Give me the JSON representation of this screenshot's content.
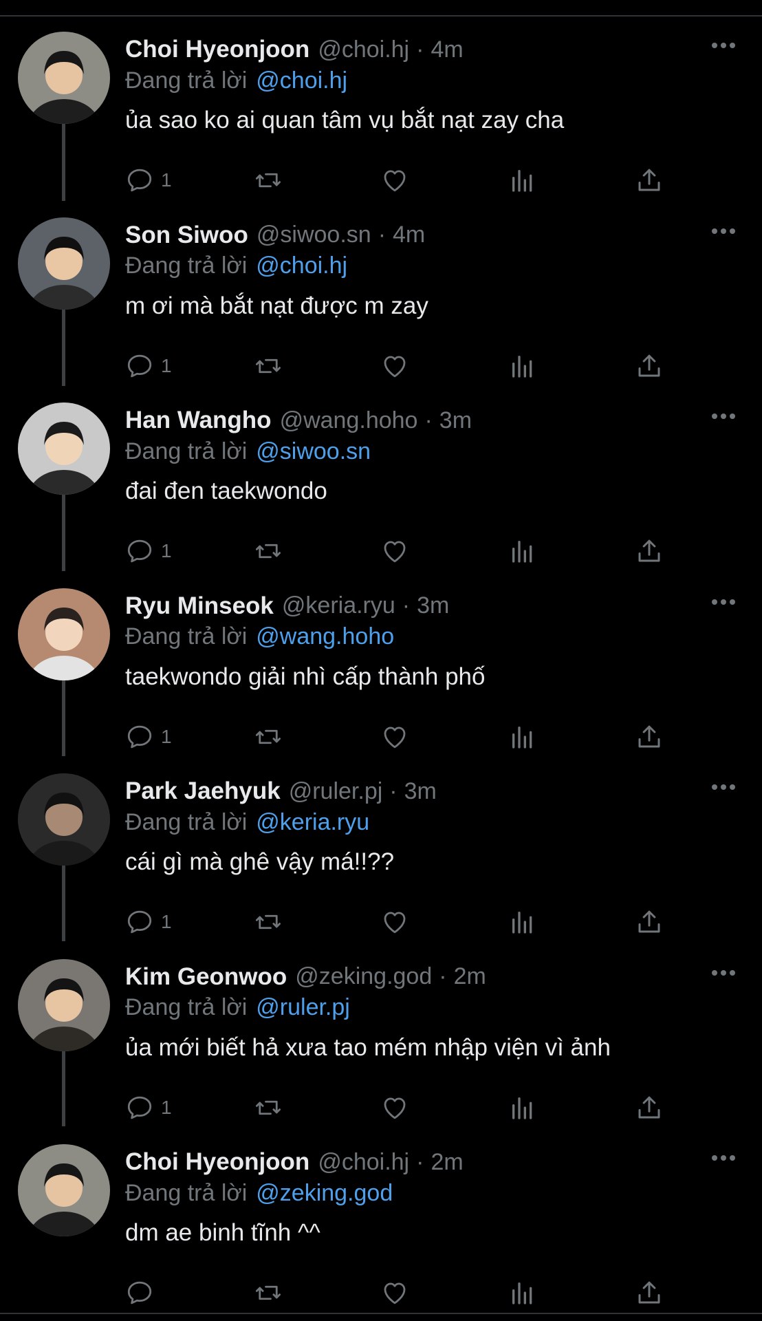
{
  "thread": {
    "reply_prefix": "Đang trả lời",
    "more_icon": "more-horizontal-icon",
    "tweets": [
      {
        "name": "Choi Hyeonjoon",
        "handle": "@choi.hj",
        "separator": "·",
        "time": "4m",
        "reply_to": "@choi.hj",
        "text": "ủa sao ko ai quan tâm vụ bắt nạt zay cha",
        "reply_count": "1"
      },
      {
        "name": "Son Siwoo",
        "handle": "@siwoo.sn",
        "separator": "·",
        "time": "4m",
        "reply_to": "@choi.hj",
        "text": "m ơi mà bắt nạt được m zay",
        "reply_count": "1"
      },
      {
        "name": "Han Wangho",
        "handle": "@wang.hoho",
        "separator": "·",
        "time": "3m",
        "reply_to": "@siwoo.sn",
        "text": "đai đen taekwondo",
        "reply_count": "1"
      },
      {
        "name": "Ryu Minseok",
        "handle": "@keria.ryu",
        "separator": "·",
        "time": "3m",
        "reply_to": "@wang.hoho",
        "text": "taekwondo giải nhì cấp thành phố",
        "reply_count": "1"
      },
      {
        "name": "Park Jaehyuk",
        "handle": "@ruler.pj",
        "separator": "·",
        "time": "3m",
        "reply_to": "@keria.ryu",
        "text": "cái gì mà ghê vậy má!!??",
        "reply_count": "1"
      },
      {
        "name": "Kim Geonwoo",
        "handle": "@zeking.god",
        "separator": "·",
        "time": "2m",
        "reply_to": "@ruler.pj",
        "text": "ủa mới biết hả xưa tao mém nhập viện vì ảnh",
        "reply_count": "1"
      },
      {
        "name": "Choi Hyeonjoon",
        "handle": "@choi.hj",
        "separator": "·",
        "time": "2m",
        "reply_to": "@zeking.god",
        "text": "dm ae binh tĩnh ^^",
        "reply_count": ""
      }
    ],
    "action_icons": [
      "reply-icon",
      "retweet-icon",
      "like-icon",
      "views-icon",
      "share-icon"
    ]
  },
  "colors": {
    "background": "#000000",
    "primary_text": "#e7e9ea",
    "secondary_text": "#71767b",
    "mention_blue": "#4ea0ec",
    "thread_line": "#3e4144",
    "divider": "#2f3336"
  }
}
